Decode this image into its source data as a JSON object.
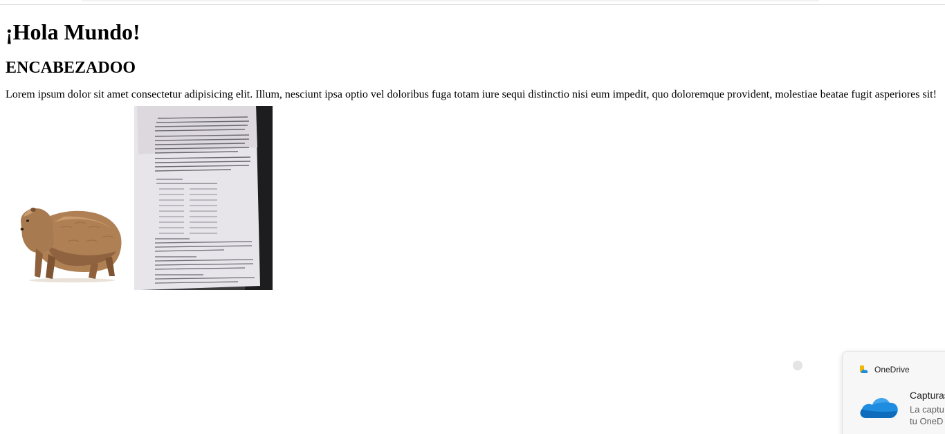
{
  "page": {
    "heading": "¡Hola Mundo!",
    "subheading": "ENCABEZADOO",
    "paragraph": "Lorem ipsum dolor sit amet consectetur adipisicing elit. Illum, nesciunt ipsa optio vel doloribus fuga totam iure sequi distinctio nisi eum impedit, quo doloremque provident, molestiae beatae fugit asperiores sit!"
  },
  "images": {
    "capybara_icon": "capybara-photo",
    "document_icon": "printed-document-photo"
  },
  "notification": {
    "app_name": "OneDrive",
    "title": "Capturas",
    "body_line1": "La captu",
    "body_line2": "tu OneD",
    "app_icon": "onedrive-icon",
    "accent": "#1e8de0"
  }
}
